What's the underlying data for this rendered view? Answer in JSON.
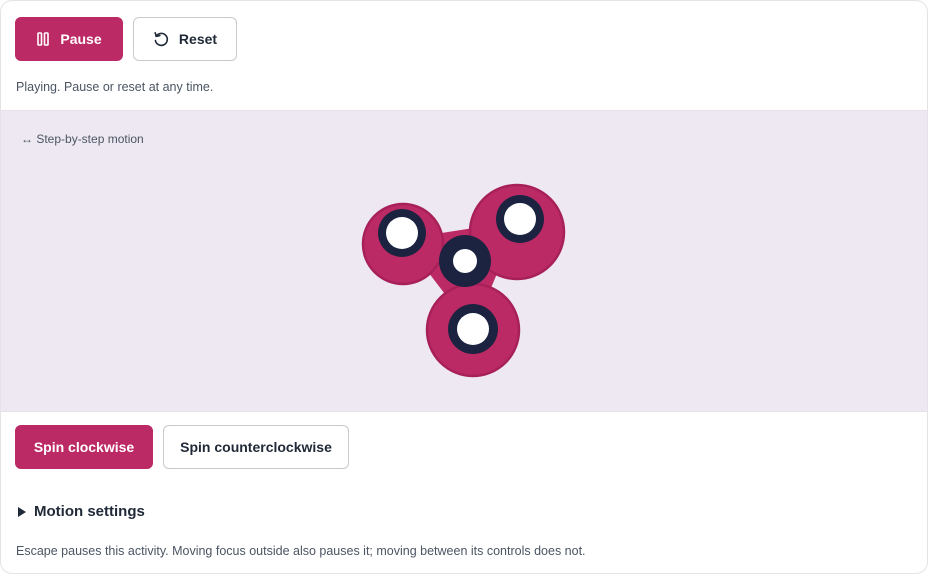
{
  "toolbar": {
    "pause_label": "Pause",
    "reset_label": "Reset"
  },
  "status": {
    "text": "Playing. Pause or reset at any time."
  },
  "stage": {
    "caption": "↔ Step-by-step motion"
  },
  "controls": {
    "clockwise_label": "Spin clockwise",
    "counterclockwise_label": "Spin counterclockwise"
  },
  "settings": {
    "summary": "Motion settings"
  },
  "footer": {
    "note": "Escape pauses this activity. Moving focus outside also pauses it; moving between its controls does not."
  },
  "icons": {
    "pause": "pause-icon",
    "reset": "reset-icon",
    "disclosure": "triangle-right-icon"
  },
  "colors": {
    "accent": "#bc2a65",
    "spinner_body": "#bc2a65",
    "spinner_ring": "#1c2340",
    "stage_background": "#ede8f2"
  }
}
